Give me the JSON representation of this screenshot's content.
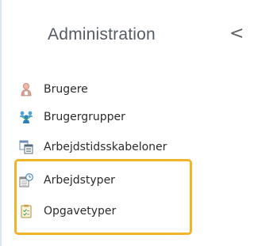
{
  "sidebar": {
    "title": "Administration",
    "collapse_glyph": "<",
    "items": [
      {
        "label": "Brugere",
        "icon": "user-icon"
      },
      {
        "label": "Brugergrupper",
        "icon": "user-group-icon"
      },
      {
        "label": "Arbejdstidsskabeloner",
        "icon": "calendar-template-icon"
      },
      {
        "label": "Arbejdstyper",
        "icon": "work-types-icon"
      },
      {
        "label": "Opgavetyper",
        "icon": "task-types-icon"
      }
    ]
  },
  "highlight": {
    "color": "#f0b429"
  }
}
